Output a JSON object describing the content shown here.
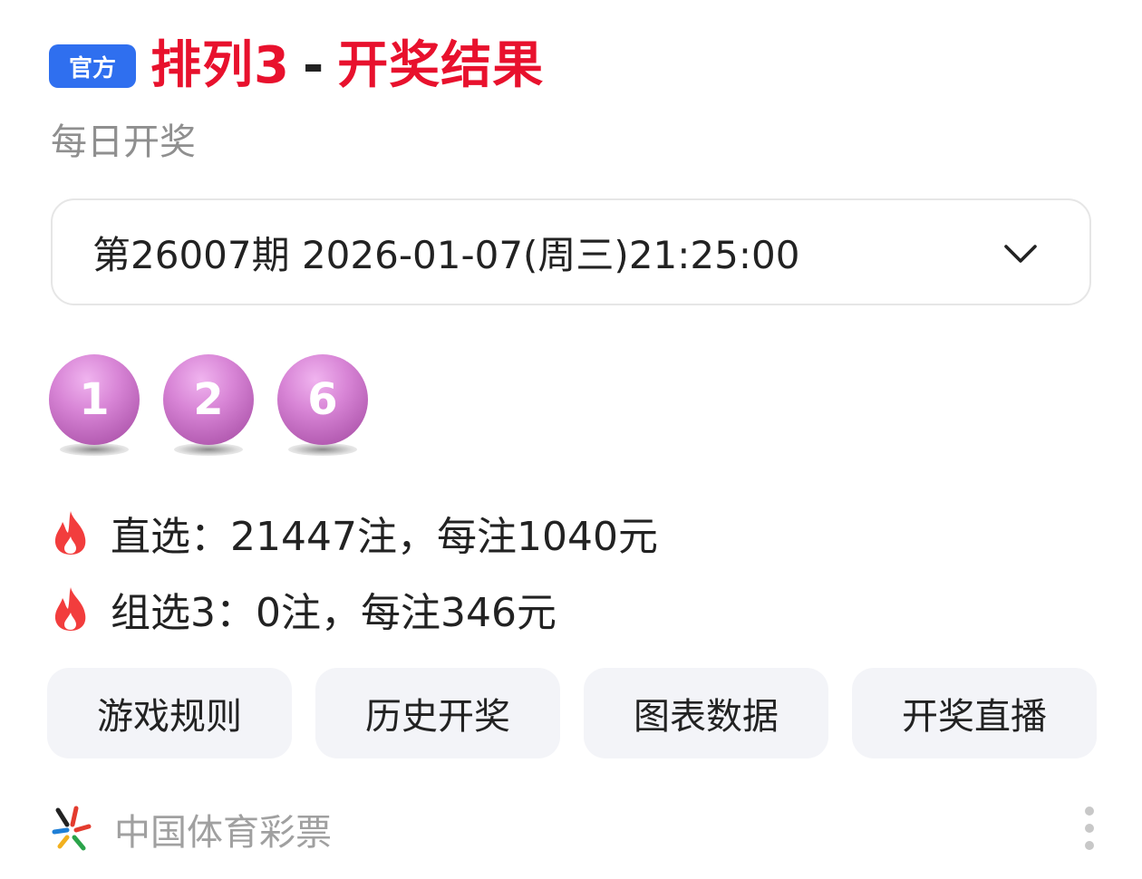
{
  "header": {
    "badge": "官方",
    "title_main": "排列3",
    "title_dash": "-",
    "title_sub": "开奖结果",
    "subtitle": "每日开奖"
  },
  "period_select": {
    "selected": "第26007期 2026-01-07(周三)21:25:00",
    "icon": "chevron-down-icon"
  },
  "draw": {
    "numbers": [
      "1",
      "2",
      "6"
    ],
    "ball_color": "#d07ccf"
  },
  "prizes": [
    {
      "icon": "flame-icon",
      "text": "直选：21447注，每注1040元"
    },
    {
      "icon": "flame-icon",
      "text": "组选3：0注，每注346元"
    }
  ],
  "actions": [
    {
      "label": "游戏规则"
    },
    {
      "label": "历史开奖"
    },
    {
      "label": "图表数据"
    },
    {
      "label": "开奖直播"
    }
  ],
  "footer": {
    "source": "中国体育彩票",
    "logo_icon": "china-sports-lottery-logo-icon",
    "more_icon": "more-vertical-icon"
  },
  "colors": {
    "title_red": "#e8112d",
    "badge_blue": "#2f6fef",
    "flame_red": "#f23d3d",
    "button_bg": "#f3f4f8"
  }
}
